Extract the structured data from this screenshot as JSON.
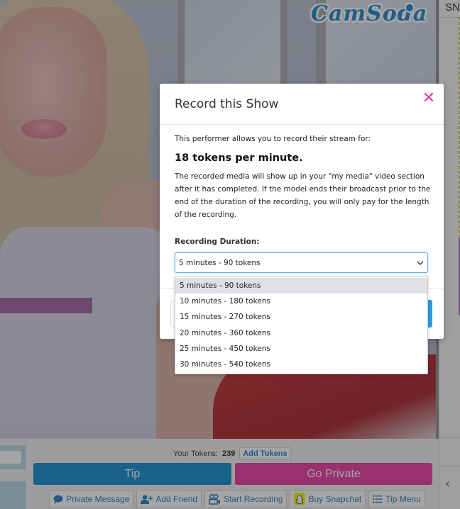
{
  "brand": {
    "logo_text": "CamSoda"
  },
  "right_panel": {
    "tab_label": "SNA",
    "collapse_icon": "chevron-left-icon"
  },
  "modal": {
    "title": "Record this Show",
    "close_icon": "close-icon",
    "close_glyph": "✕",
    "intro": "This performer allows you to record their stream for:",
    "rate": "18 tokens per minute.",
    "description": "The recorded media will show up in your \"my media\" video section after it has completed. If the model ends their broadcast prior to the end of the duration of the recording, you will only pay for the length of the recording.",
    "duration_label": "Recording Duration:",
    "selected_duration": "5 minutes - 90 tokens",
    "duration_options": [
      "5 minutes - 90 tokens",
      "10 minutes - 180 tokens",
      "15 minutes - 270 tokens",
      "20 minutes - 360 tokens",
      "25 minutes - 450 tokens",
      "30 minutes - 540 tokens"
    ]
  },
  "controls": {
    "tokens_label": "Your Tokens:",
    "tokens_count": "239",
    "add_tokens": "Add Tokens",
    "tip": "Tip",
    "go_private": "Go Private",
    "actions": [
      {
        "label": "Private Message",
        "icon": "chat-bubble-icon"
      },
      {
        "label": "Add Friend",
        "icon": "add-user-icon"
      },
      {
        "label": "Start Recording",
        "icon": "video-camera-icon"
      },
      {
        "label": "Buy Snapchat",
        "icon": "snapchat-icon"
      },
      {
        "label": "Tip Menu",
        "icon": "list-icon"
      }
    ]
  },
  "colors": {
    "tip_blue": "#0f8dd0",
    "private_pink": "#e9389f",
    "close_pink": "#e83aa2",
    "link_blue": "#1d7bbd",
    "select_focus": "#5bb4e6"
  }
}
